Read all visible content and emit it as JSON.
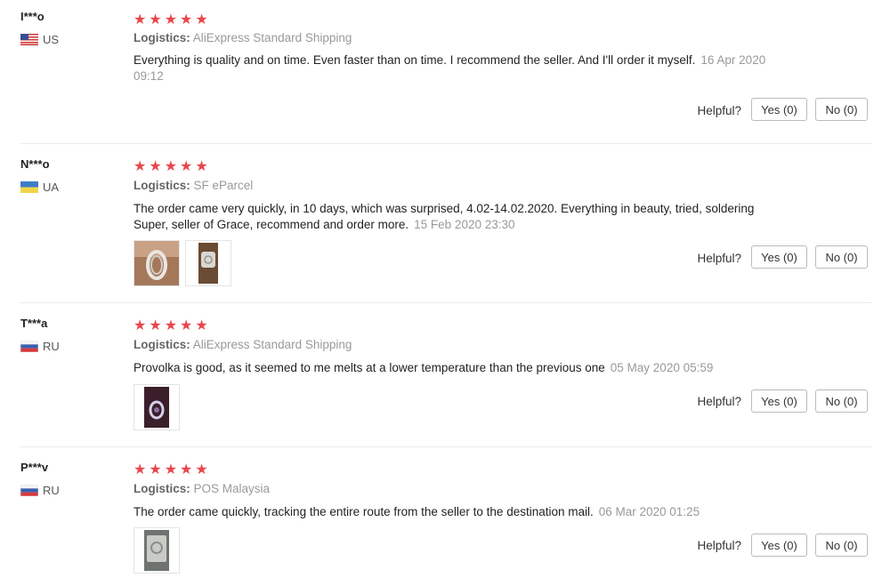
{
  "reviews": [
    {
      "user": "I***o",
      "country": "US",
      "flag": "us-flag-icon",
      "stars": "★★★★★",
      "rating": 5,
      "logistics_label": "Logistics:",
      "logistics": "AliExpress Standard Shipping",
      "text": "Everything is quality and on time. Even faster than on time. I recommend the seller. And I'll order it myself.",
      "date": "16 Apr 2020 09:12",
      "helpful": "Helpful?",
      "yes": "Yes (0)",
      "no": "No (0)"
    },
    {
      "user": "N***o",
      "country": "UA",
      "flag": "ua-flag-icon",
      "stars": "★★★★★",
      "rating": 5,
      "logistics_label": "Logistics:",
      "logistics": "SF eParcel",
      "text": "The order came very quickly, in 10 days, which was surprised, 4.02-14.02.2020. Everything in beauty, tried, soldering Super, seller of Grace, recommend and order more.",
      "date": "15 Feb 2020 23:30",
      "helpful": "Helpful?",
      "yes": "Yes (0)",
      "no": "No (0)"
    },
    {
      "user": "T***a",
      "country": "RU",
      "flag": "ru-flag-icon",
      "stars": "★★★★★",
      "rating": 5,
      "logistics_label": "Logistics:",
      "logistics": "AliExpress Standard Shipping",
      "text": "Provolka is good, as it seemed to me melts at a lower temperature than the previous one",
      "date": "05 May 2020 05:59",
      "helpful": "Helpful?",
      "yes": "Yes (0)",
      "no": "No (0)"
    },
    {
      "user": "P***v",
      "country": "RU",
      "flag": "ru-flag-icon",
      "stars": "★★★★★",
      "rating": 5,
      "logistics_label": "Logistics:",
      "logistics": "POS Malaysia",
      "text": "The order came quickly, tracking the entire route from the seller to the destination mail.",
      "date": "06 Mar 2020 01:25",
      "helpful": "Helpful?",
      "yes": "Yes (0)",
      "no": "No (0)"
    }
  ],
  "colors": {
    "star": "#e8474c",
    "muted": "#999999",
    "divider": "#ececec"
  }
}
